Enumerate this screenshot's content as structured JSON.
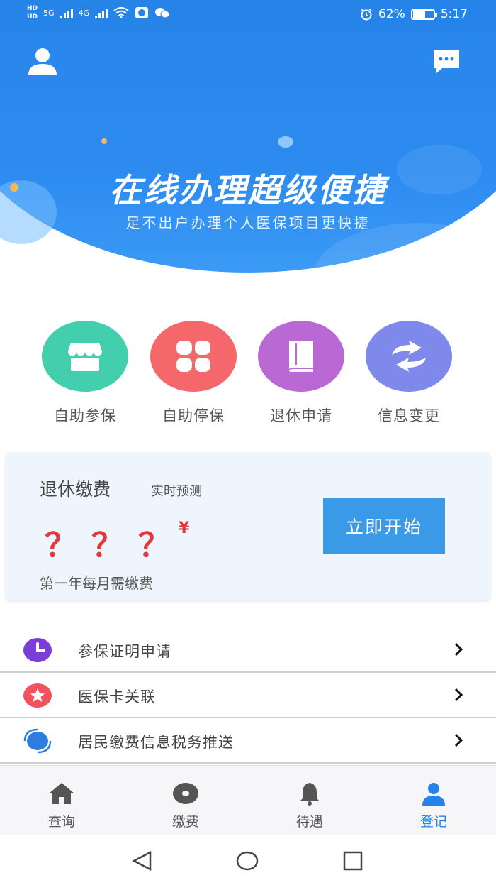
{
  "status_bar": {
    "hd_top": "HD",
    "hd_bottom": "HD",
    "net1": "5G",
    "net2": "4G",
    "battery_percent": "62%",
    "battery_level": 0.62,
    "time": "5:17"
  },
  "hero": {
    "title": "在线办理超级便捷",
    "subtitle": "足不出户办理个人医保项目更快捷"
  },
  "actions": [
    {
      "label": "自助参保",
      "icon": "store-icon",
      "color": "#43cfae"
    },
    {
      "label": "自助停保",
      "icon": "grid-icon",
      "color": "#f4686b"
    },
    {
      "label": "退休申请",
      "icon": "book-icon",
      "color": "#b968d4"
    },
    {
      "label": "信息变更",
      "icon": "exchange-icon",
      "color": "#7f89ec"
    }
  ],
  "card": {
    "title": "退休缴费",
    "tag": "实时预测",
    "amount": "？？？",
    "currency": "¥",
    "note": "第一年每月需缴费",
    "button": "立即开始",
    "button_color": "#3b9ae8"
  },
  "list": [
    {
      "label": "参保证明申请",
      "icon": "clock-icon",
      "color": "#7a3ed6"
    },
    {
      "label": "医保卡关联",
      "icon": "star-icon",
      "color": "#f0525e"
    },
    {
      "label": "居民缴费信息税务推送",
      "icon": "sync-icon",
      "color": "#2f7de0"
    }
  ],
  "tabs": [
    {
      "label": "查询",
      "icon": "home-icon",
      "active": false
    },
    {
      "label": "缴费",
      "icon": "disc-icon",
      "active": false
    },
    {
      "label": "待遇",
      "icon": "bell-icon",
      "active": false
    },
    {
      "label": "登记",
      "icon": "person-icon",
      "active": true
    }
  ],
  "colors": {
    "primary": "#2684e8",
    "active_tab": "#2684e8"
  }
}
